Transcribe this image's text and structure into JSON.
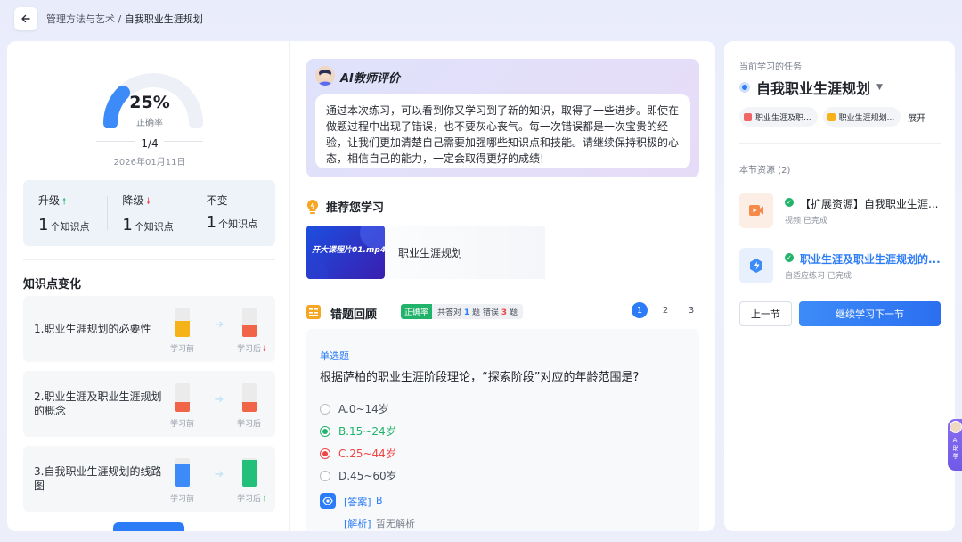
{
  "breadcrumb": {
    "parent": "管理方法与艺术 /",
    "current": "自我职业生涯规划"
  },
  "summary": {
    "percent": "25%",
    "percent_value": 0.25,
    "percent_label": "正确率",
    "progress": "1/4",
    "date": "2026年01月11日"
  },
  "stats": [
    {
      "label": "升级",
      "arrow": "🠕",
      "value": "1",
      "unit": "个知识点"
    },
    {
      "label": "降级",
      "arrow": "🠗",
      "value": "1",
      "unit": "个知识点"
    },
    {
      "label": "不变",
      "arrow": "",
      "value": "1",
      "unit": "个知识点"
    }
  ],
  "knowledge": {
    "title": "知识点变化",
    "before_label": "学习前",
    "after_label": "学习后",
    "items": [
      {
        "name": "1.职业生涯规划的必要性",
        "before_color": "#f5b319",
        "before_level": 0.55,
        "after_color": "#f06548",
        "after_level": 0.4,
        "trend": "🠗"
      },
      {
        "name": "2.职业生涯及职业生涯规划的概念",
        "before_color": "#f06548",
        "before_level": 0.35,
        "after_color": "#f06548",
        "after_level": 0.35,
        "trend": ""
      },
      {
        "name": "3.自我职业生涯规划的线路图",
        "before_color": "#3d8bf8",
        "before_level": 0.8,
        "after_color": "#22c07a",
        "after_level": 0.95,
        "trend": "🠕"
      }
    ]
  },
  "ai": {
    "title": "AI教师评价",
    "text": "通过本次练习，可以看到你又学习到了新的知识，取得了一些进步。即使在做题过程中出现了错误，也不要灰心丧气。每一次错误都是一次宝贵的经验，让我们更加清楚自己需要加强哪些知识点和技能。请继续保持积极的心态，相信自己的能力，一定会取得更好的成绩!"
  },
  "recommend": {
    "title": "推荐您学习",
    "thumb_text": "开大课程片01.mp4",
    "name": "职业生涯规划"
  },
  "review": {
    "title": "错题回顾",
    "badge_label": "正确率",
    "badge_pre": "共答对",
    "badge_right": "1",
    "badge_mid": "题 错误",
    "badge_wrong": "3",
    "badge_post": "题",
    "pages": [
      "1",
      "2",
      "3"
    ],
    "question": {
      "type": "单选题",
      "stem": "根据萨柏的职业生涯阶段理论，“探索阶段”对应的年龄范围是?",
      "options": [
        {
          "text": "A.0~14岁",
          "state": "none"
        },
        {
          "text": "B.15~24岁",
          "state": "correct"
        },
        {
          "text": "C.25~44岁",
          "state": "wrong"
        },
        {
          "text": "D.45~60岁",
          "state": "none"
        }
      ],
      "answer_label": "[答案]",
      "answer": "B",
      "analysis_label": "[解析]",
      "analysis": "暂无解析"
    }
  },
  "task": {
    "caption": "当前学习的任务",
    "title": "自我职业生涯规划",
    "tags": [
      {
        "text": "职业生涯及职...",
        "color": "#f06565"
      },
      {
        "text": "职业生涯规划...",
        "color": "#f5b319"
      }
    ],
    "more": "展开",
    "section": "本节资源 (2)",
    "resources": [
      {
        "name": "【扩展资源】自我职业生涯...",
        "meta": "视频 已完成",
        "icon_bg": "#fdeee5",
        "icon_color": "#f58a4a"
      },
      {
        "name": "职业生涯及职业生涯规划的...",
        "meta": "自适应练习 已完成",
        "icon_bg": "#e8f0fd",
        "icon_color": "#3d8bf8"
      }
    ],
    "prev": "上一节",
    "next": "继续学习下一节"
  },
  "ai_float": {
    "label": "AI助学"
  },
  "colors": {
    "accent": "#2b7cf6",
    "correct": "#22b36b",
    "wrong": "#f04545"
  }
}
